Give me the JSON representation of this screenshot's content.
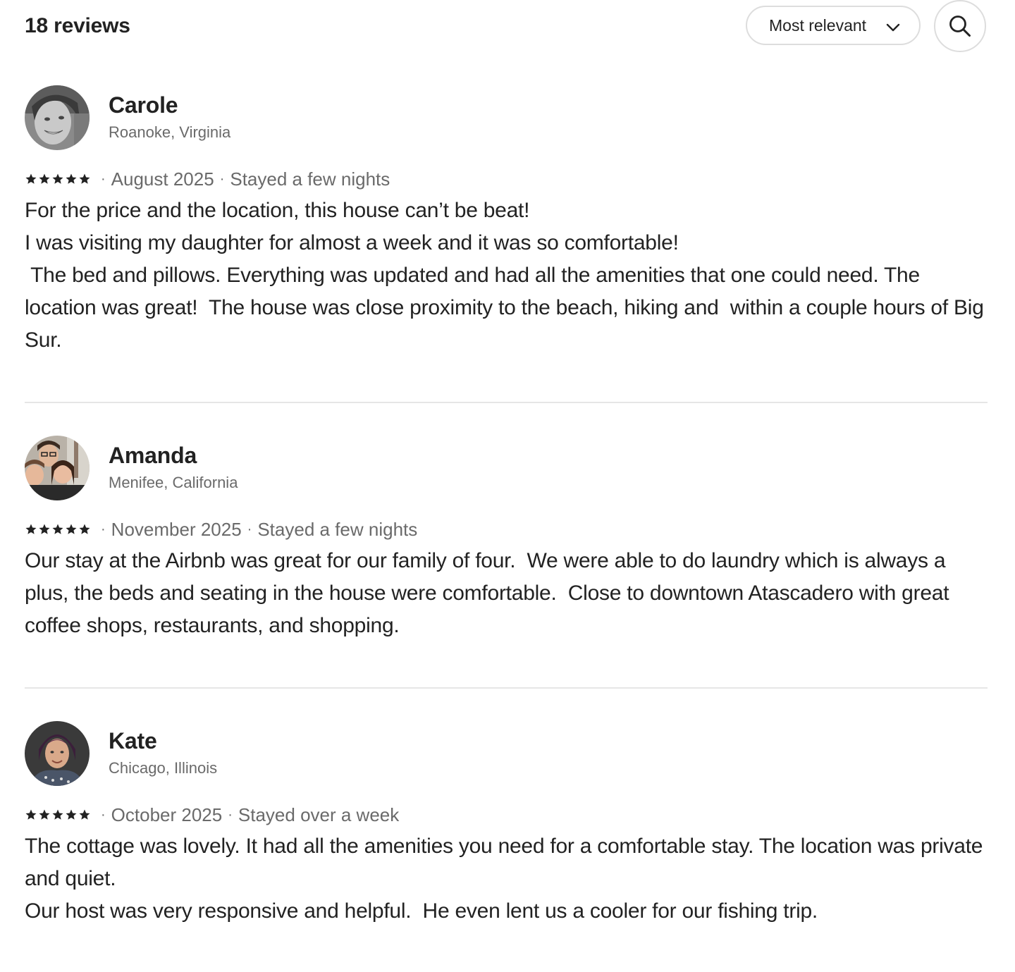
{
  "header": {
    "review_count": "18 reviews",
    "sort_label": "Most relevant",
    "sort_icon": "chevron-down-icon",
    "search_icon": "search-icon"
  },
  "reviews": [
    {
      "name": "Carole",
      "location": "Roanoke, Virginia",
      "rating": 5,
      "date": "August 2025",
      "stay": "Stayed a few nights",
      "text": "For the price and the location, this house can’t be beat!\nI was visiting my daughter for almost a week and it was so comfortable!\n The bed and pillows. Everything was updated and had all the amenities that one could need. The location was great!  The house was close proximity to the beach, hiking and  within a couple hours of Big Sur."
    },
    {
      "name": "Amanda",
      "location": "Menifee, California",
      "rating": 5,
      "date": "November 2025",
      "stay": "Stayed a few nights",
      "text": "Our stay at the Airbnb was great for our family of four.  We were able to do laundry which is always a plus, the beds and seating in the house were comfortable.  Close to downtown Atascadero with great coffee shops, restaurants, and shopping."
    },
    {
      "name": "Kate",
      "location": "Chicago, Illinois",
      "rating": 5,
      "date": "October 2025",
      "stay": "Stayed over a week",
      "text": "The cottage was lovely. It had all the amenities you need for a comfortable stay. The location was private and quiet.\nOur host was very responsive and helpful.  He even lent us a cooler for our fishing trip."
    }
  ],
  "meta_separator": "·",
  "colors": {
    "text": "#222222",
    "secondary": "#6a6a6a",
    "border": "#dddddd",
    "divider": "#e6e6e6"
  }
}
